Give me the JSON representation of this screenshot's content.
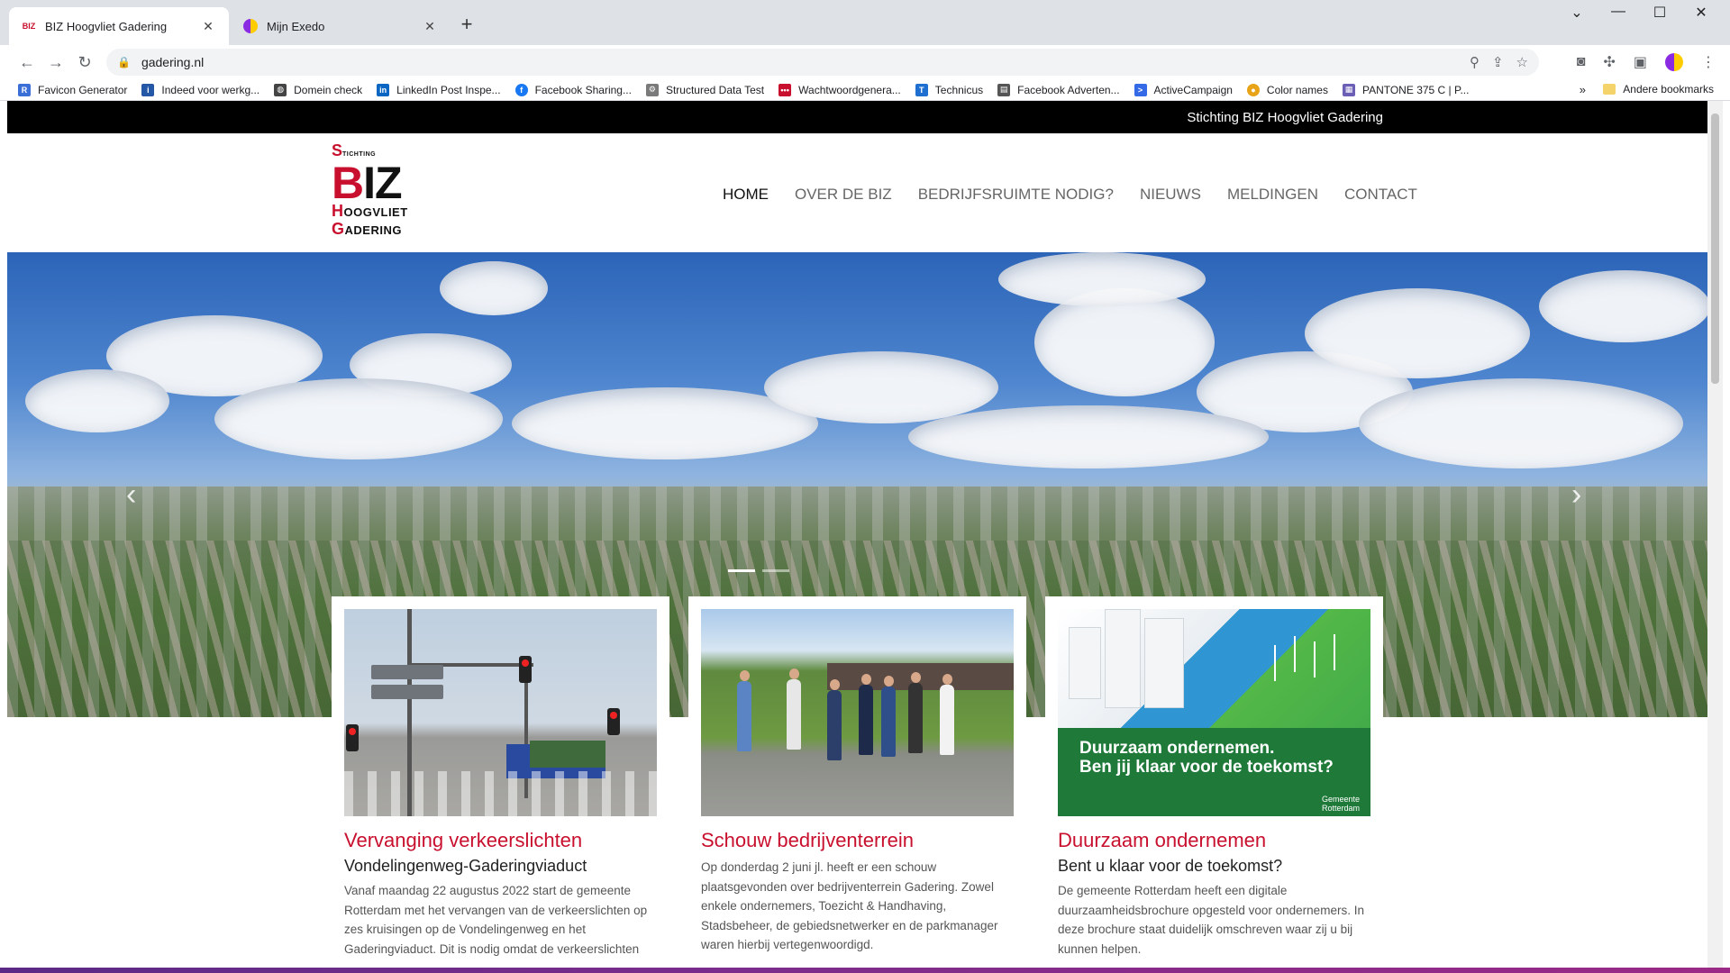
{
  "browser": {
    "tabs": [
      {
        "title": "BIZ Hoogvliet Gadering",
        "favicon": "BIZ",
        "active": true
      },
      {
        "title": "Mijn Exedo",
        "favicon": "exedo-logo",
        "active": false
      }
    ],
    "url": "gadering.nl",
    "bookmarks": [
      {
        "label": "Favicon Generator",
        "color": "#3b6fd8",
        "letter": "R"
      },
      {
        "label": "Indeed voor werkg...",
        "color": "#2557a7",
        "letter": "i"
      },
      {
        "label": "Domein check",
        "color": "#444444",
        "letter": "◍"
      },
      {
        "label": "LinkedIn Post Inspe...",
        "color": "#0a66c2",
        "letter": "in"
      },
      {
        "label": "Facebook Sharing...",
        "color": "#1877f2",
        "letter": "f"
      },
      {
        "label": "Structured Data Test",
        "color": "#7a7a7a",
        "letter": "⚙"
      },
      {
        "label": "Wachtwoordgenera...",
        "color": "#c8102e",
        "letter": "•••"
      },
      {
        "label": "Technicus",
        "color": "#1f6fd1",
        "letter": "T"
      },
      {
        "label": "Facebook Adverten...",
        "color": "#555555",
        "letter": "▤"
      },
      {
        "label": "ActiveCampaign",
        "color": "#356ae6",
        "letter": ">"
      },
      {
        "label": "Color names",
        "color": "#e8a317",
        "letter": "●"
      },
      {
        "label": "PANTONE 375 C | P...",
        "color": "#6b5fb5",
        "letter": "▦"
      }
    ],
    "bookmarks_more": "»",
    "other_bookmarks": "Andere bookmarks"
  },
  "site": {
    "topbar_text": "Stichting BIZ Hoogvliet Gadering",
    "logo": {
      "s": "S",
      "stichting": "TICHTING",
      "b": "B",
      "iz": "IZ",
      "h": "H",
      "hoogvliet": "OOGVLIET",
      "g": "G",
      "gadering": "ADERING"
    },
    "nav": [
      {
        "label": "HOME",
        "active": true
      },
      {
        "label": "OVER DE BIZ",
        "active": false
      },
      {
        "label": "BEDRIJFSRUIMTE NODIG?",
        "active": false
      },
      {
        "label": "NIEUWS",
        "active": false
      },
      {
        "label": "MELDINGEN",
        "active": false
      },
      {
        "label": "CONTACT",
        "active": false
      }
    ],
    "cards": [
      {
        "title": "Vervanging verkeerslichten",
        "subtitle": "Vondelingenweg-Gaderingviaduct",
        "text": "Vanaf maandag 22 augustus 2022 start de gemeente Rotterdam met het vervangen van de verkeerslichten op zes kruisingen op de Vondelingenweg en het Gaderingviaduct. Dit is nodig omdat de verkeerslichten"
      },
      {
        "title": "Schouw bedrijventerrein",
        "subtitle": "",
        "text": "Op donderdag 2 juni jl. heeft er een schouw plaatsgevonden over bedrijventerrein Gadering. Zowel enkele ondernemers, Toezicht & Handhaving, Stadsbeheer, de gebiedsnetwerker en de parkmanager waren hierbij vertegenwoordigd."
      },
      {
        "title": "Duurzaam ondernemen",
        "subtitle": "Bent u klaar voor de toekomst?",
        "text": "De gemeente Rotterdam heeft een digitale duurzaamheidsbrochure opgesteld voor ondernemers. In deze brochure staat duidelijk omschreven waar zij u bij kunnen helpen."
      }
    ],
    "card3_banner": {
      "line1": "Duurzaam ondernemen.",
      "line2": "Ben jij klaar voor de toekomst?",
      "org1": "Gemeente",
      "org2": "Rotterdam"
    },
    "colors": {
      "accent": "#c8102e",
      "topbar": "#000000"
    }
  }
}
